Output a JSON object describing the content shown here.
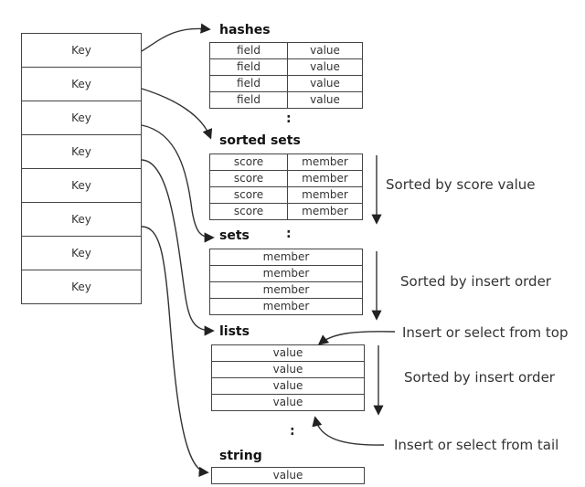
{
  "keys": [
    "Key",
    "Key",
    "Key",
    "Key",
    "Key",
    "Key",
    "Key",
    "Key"
  ],
  "ellipsis": ":",
  "hashes": {
    "title": "hashes",
    "rows": [
      [
        "field",
        "value"
      ],
      [
        "field",
        "value"
      ],
      [
        "field",
        "value"
      ],
      [
        "field",
        "value"
      ]
    ]
  },
  "sorted_sets": {
    "title": "sorted  sets",
    "rows": [
      [
        "score",
        "member"
      ],
      [
        "score",
        "member"
      ],
      [
        "score",
        "member"
      ],
      [
        "score",
        "member"
      ]
    ],
    "note": "Sorted by score value"
  },
  "sets": {
    "title": "sets",
    "rows": [
      "member",
      "member",
      "member",
      "member"
    ],
    "note": "Sorted by insert order"
  },
  "lists": {
    "title": "lists",
    "rows": [
      "value",
      "value",
      "value",
      "value"
    ],
    "note": "Sorted by insert order",
    "note_top": "Insert or select from top",
    "note_tail": "Insert or select from tail"
  },
  "string": {
    "title": "string",
    "value": "value"
  }
}
